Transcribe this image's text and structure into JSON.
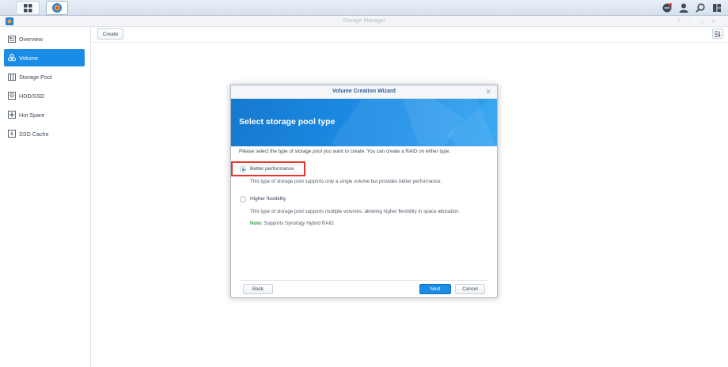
{
  "window": {
    "title": "Storage Manager"
  },
  "toolbar": {
    "create_label": "Create"
  },
  "sidebar": {
    "items": [
      {
        "label": "Overview",
        "icon": "overview-icon"
      },
      {
        "label": "Volume",
        "icon": "volume-icon",
        "active": true
      },
      {
        "label": "Storage Pool",
        "icon": "storage-pool-icon"
      },
      {
        "label": "HDD/SSD",
        "icon": "hdd-icon"
      },
      {
        "label": "Hot Spare",
        "icon": "hot-spare-icon"
      },
      {
        "label": "SSD Cache",
        "icon": "ssd-cache-icon"
      }
    ]
  },
  "dialog": {
    "title": "Volume Creation Wizard",
    "banner_title": "Select storage pool type",
    "description": "Please select the type of storage pool you want to create. You can create a RAID on either type.",
    "options": [
      {
        "label": "Better performance",
        "description": "This type of storage pool supports only a single volume but provides better performance.",
        "selected": true
      },
      {
        "label": "Higher flexibility",
        "description": "This type of storage pool supports multiple volumes, allowing higher flexibility in space allocation.",
        "selected": false
      }
    ],
    "note_label": "Note:",
    "note_text": " Supports Synology Hybrid RAID.",
    "back_label": "Back",
    "next_label": "Next",
    "cancel_label": "Cancel"
  },
  "colors": {
    "accent": "#1b8ce6",
    "highlight": "#e8352f",
    "note": "#3fa34d"
  }
}
